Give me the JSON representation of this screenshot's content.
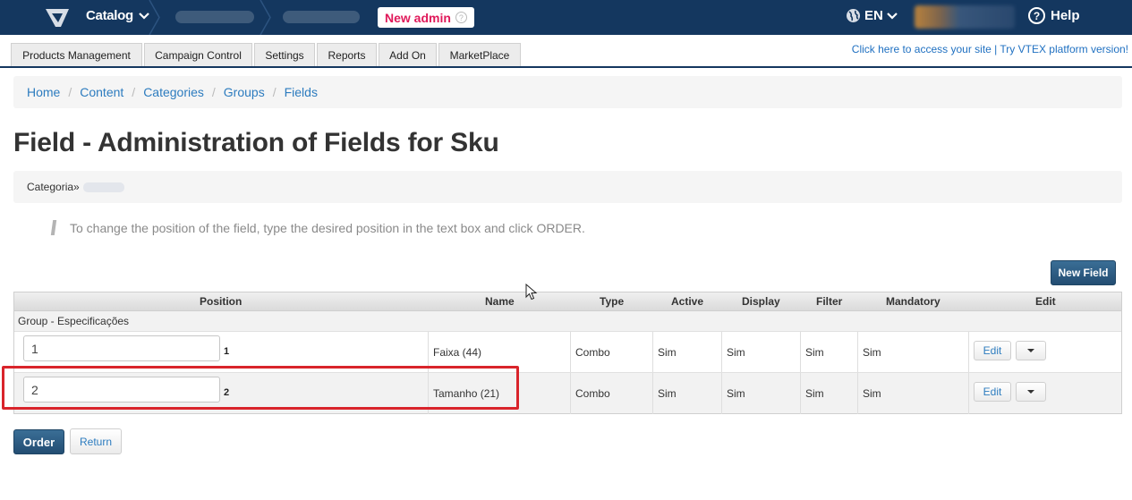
{
  "topbar": {
    "catalog_label": "Catalog",
    "new_admin_label": "New admin",
    "help_icon_label": "?",
    "language": "EN",
    "help_label": "Help"
  },
  "menu": {
    "tabs": [
      "Products Management",
      "Campaign Control",
      "Settings",
      "Reports",
      "Add On",
      "MarketPlace"
    ],
    "site_link": "Click here to access your site | Try VTEX platform version!"
  },
  "breadcrumb": [
    "Home",
    "Content",
    "Categories",
    "Groups",
    "Fields"
  ],
  "page_title": "Field - Administration of Fields for Sku",
  "category_label": "Categoria»",
  "note": "To change the position of the field, type the desired position in the text box and click ORDER.",
  "new_field_label": "New Field",
  "table": {
    "headers": [
      "Position",
      "Name",
      "Type",
      "Active",
      "Display",
      "Filter",
      "Mandatory",
      "Edit"
    ],
    "group": "Group - Especificações",
    "rows": [
      {
        "position_value": "1",
        "position": "1",
        "name": "Faixa (44)",
        "type": "Combo",
        "active": "Sim",
        "display": "Sim",
        "filter": "Sim",
        "mandatory": "Sim",
        "edit": "Edit"
      },
      {
        "position_value": "2",
        "position": "2",
        "name": "Tamanho (21)",
        "type": "Combo",
        "active": "Sim",
        "display": "Sim",
        "filter": "Sim",
        "mandatory": "Sim",
        "edit": "Edit"
      }
    ]
  },
  "actions": {
    "order_label": "Order",
    "return_label": "Return"
  },
  "colors": {
    "topbar": "#14375f",
    "link": "#2d7cbf",
    "brand_pink": "#e0195a",
    "highlight": "#d9242b"
  }
}
